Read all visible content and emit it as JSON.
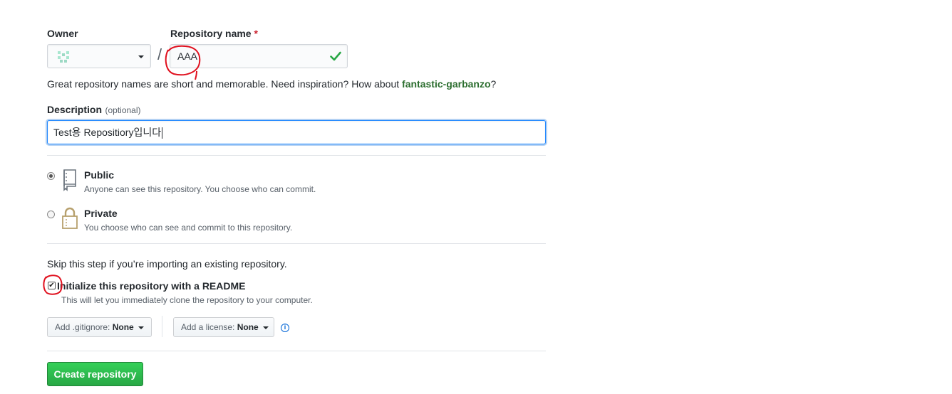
{
  "owner": {
    "label": "Owner"
  },
  "repo_name": {
    "label": "Repository name",
    "required_mark": "*",
    "value": "AAA"
  },
  "separator": "/",
  "name_hint": {
    "prefix": "Great repository names are short and memorable. Need inspiration? How about ",
    "suggestion": "fantastic-garbanzo",
    "suffix": "?"
  },
  "description": {
    "label": "Description",
    "optional": "(optional)",
    "value": "Test용 Repositiory입니다"
  },
  "visibility": {
    "public": {
      "title": "Public",
      "note": "Anyone can see this repository. You choose who can commit.",
      "checked": true
    },
    "private": {
      "title": "Private",
      "note": "You choose who can see and commit to this repository.",
      "checked": false
    }
  },
  "skip_note": "Skip this step if you’re importing an existing repository.",
  "readme": {
    "title": "Initialize this repository with a README",
    "note": "This will let you immediately clone the repository to your computer.",
    "checked": true
  },
  "gitignore": {
    "prefix": "Add .gitignore: ",
    "value": "None"
  },
  "license": {
    "prefix": "Add a license: ",
    "value": "None"
  },
  "create_button": "Create repository",
  "colors": {
    "accent_green": "#28a745",
    "link_blue": "#0366d6",
    "annotation_red": "#e0101e"
  },
  "icons": [
    "identicon",
    "caret-down-icon",
    "check-icon",
    "repo-book-icon",
    "lock-icon",
    "info-icon"
  ]
}
